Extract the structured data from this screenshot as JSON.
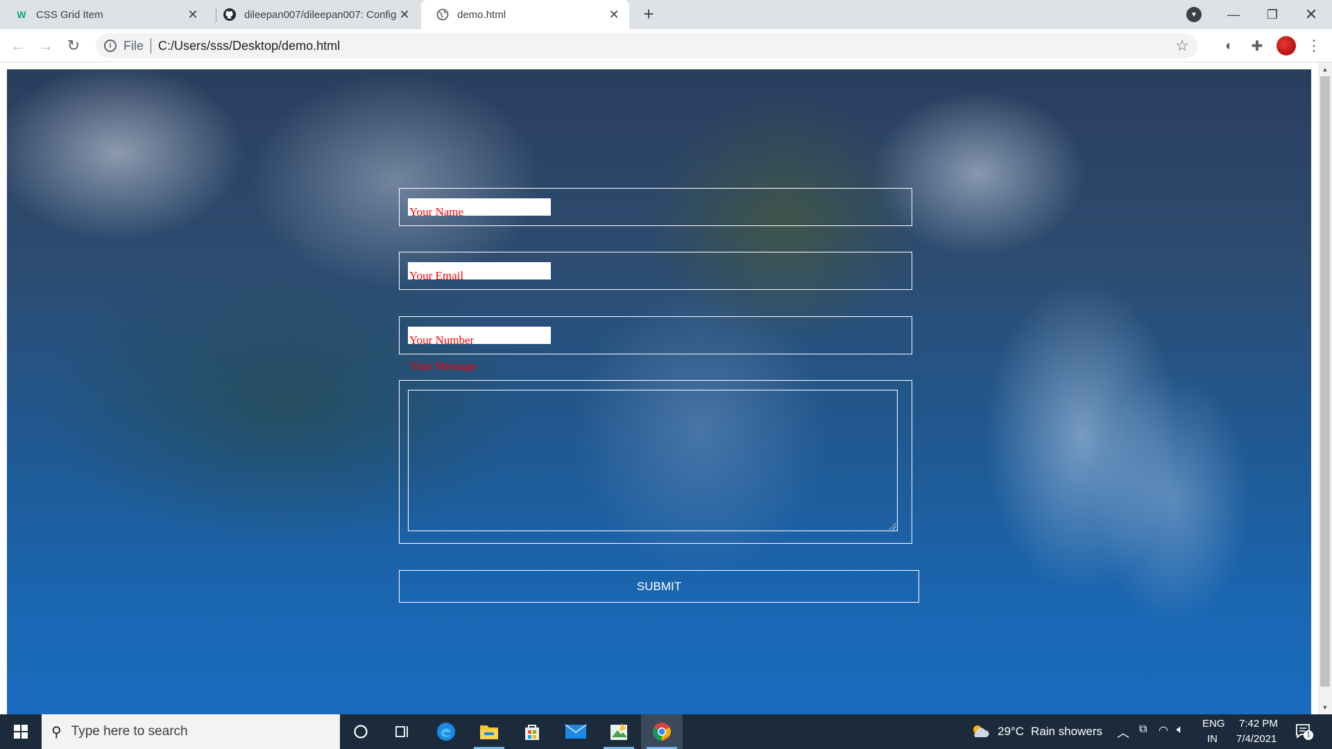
{
  "browser": {
    "tabs": [
      {
        "label": "CSS Grid Item",
        "favicon": "w3schools-icon",
        "active": false
      },
      {
        "label": "dileepan007/dileepan007: Config",
        "favicon": "github-icon",
        "active": false
      },
      {
        "label": "demo.html",
        "favicon": "globe-icon",
        "active": true
      }
    ],
    "address": {
      "scheme_label": "File",
      "url": "C:/Users/sss/Desktop/demo.html"
    }
  },
  "form": {
    "name_label": "Your Name",
    "email_label": "Your Email",
    "number_label": "Your Number",
    "message_label": "Your Message",
    "submit_label": "SUBMIT",
    "label_color": "#ff0000"
  },
  "taskbar": {
    "search_placeholder": "Type here to search",
    "weather": {
      "temp": "29°C",
      "condition": "Rain showers"
    },
    "language": {
      "line1": "ENG",
      "line2": "IN"
    },
    "clock": {
      "time": "7:42 PM",
      "date": "7/4/2021"
    },
    "notification_count": "1"
  }
}
